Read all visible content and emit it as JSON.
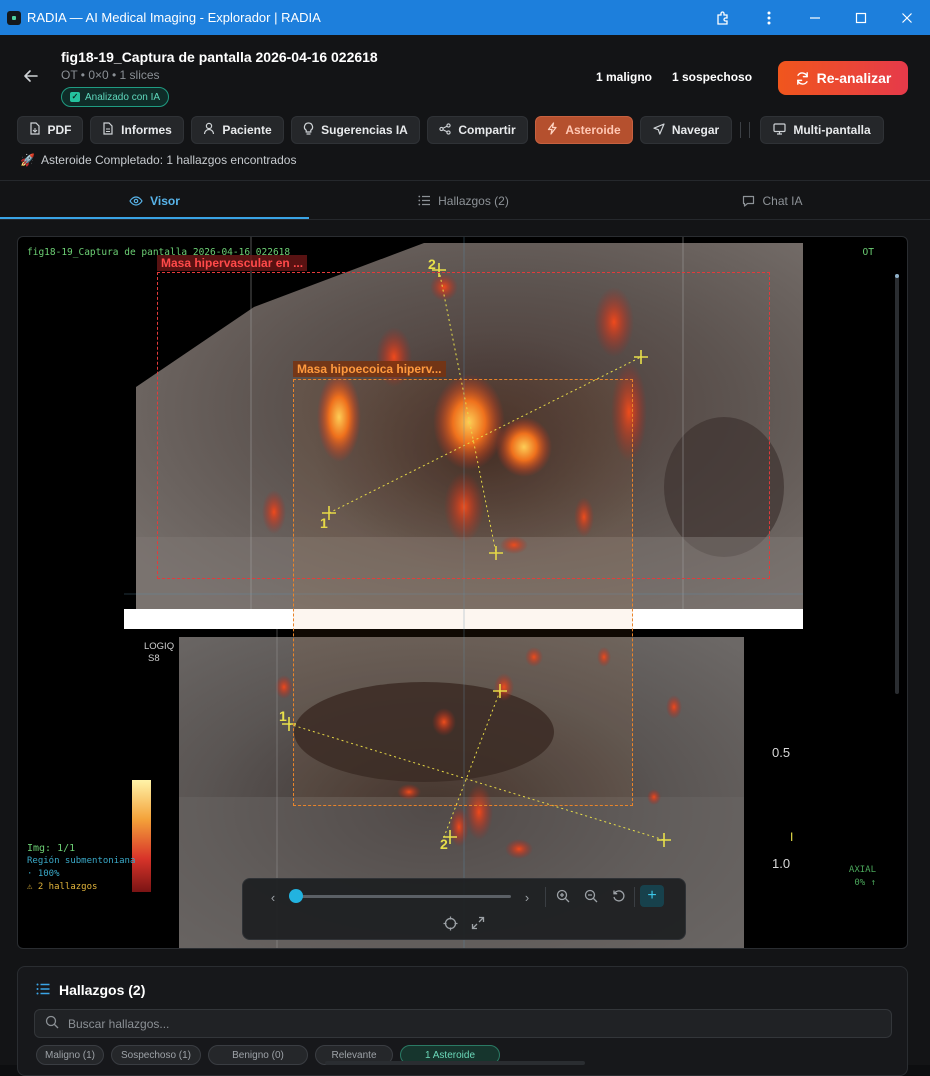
{
  "window": {
    "title": "RADIA — AI Medical Imaging - Explorador | RADIA",
    "icons": [
      "extension-icon",
      "more-icon",
      "minimize-icon",
      "maximize-icon",
      "close-icon"
    ]
  },
  "header": {
    "title": "fig18-19_Captura de pantalla 2026-04-16 022618",
    "meta": "OT • 0×0 • 1 slices",
    "ai_badge": "Analizado con IA",
    "malignant_count": "1 maligno",
    "suspicious_count": "1 sospechoso",
    "reanalyze_label": "Re-analizar"
  },
  "toolbar": {
    "pdf": "PDF",
    "reports": "Informes",
    "patient": "Paciente",
    "ai_suggestions": "Sugerencias IA",
    "share": "Compartir",
    "asteroid": "Asteroide",
    "navigate": "Navegar",
    "multi_screen": "Multi-pantalla"
  },
  "status": {
    "text": "Asteroide Completado: 1 hallazgos encontrados"
  },
  "tabs": {
    "viewer": "Visor",
    "findings": "Hallazgos (2)",
    "chat": "Chat IA"
  },
  "viewer": {
    "filename": "fig18-19_Captura de pantalla 2026-04-16 022618",
    "modality": "OT",
    "box1_label": "Masa hipervascular en ...",
    "box2_label": "Masa hipoecoica hiperv...",
    "img_index": "Img: 1/1",
    "region": "Región submentoniana",
    "zoom": "· 100%",
    "findings_count": "⚠ 2 hallazgos",
    "orientation": "AXIAL",
    "position": "0% ↑",
    "us_device": "LOGIQ",
    "us_model": "S8",
    "scale_1": "0.5",
    "scale_2": "1.0",
    "colors": {
      "box1": "#e23b3b",
      "box2": "#e9842a",
      "crosshair": "#e8e04a"
    }
  },
  "findings_panel": {
    "title": "Hallazgos (2)",
    "search_placeholder": "Buscar hallazgos...",
    "chips": [
      "Maligno (1)",
      "Sospechoso (1)",
      "Benigno (0)",
      "Relevante",
      "1 Asteroide"
    ]
  }
}
